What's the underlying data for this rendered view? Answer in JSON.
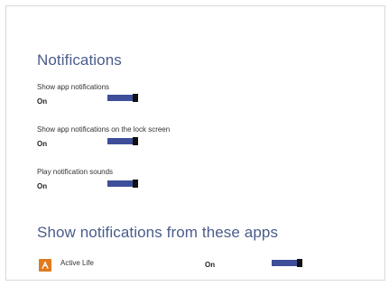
{
  "notifications": {
    "title": "Notifications",
    "settings": [
      {
        "label": "Show app notifications",
        "value": "On",
        "toggle_on": true
      },
      {
        "label": "Show app notifications on the lock screen",
        "value": "On",
        "toggle_on": true
      },
      {
        "label": "Play notification sounds",
        "value": "On",
        "toggle_on": true
      }
    ]
  },
  "apps_section": {
    "title": "Show notifications from these apps",
    "apps": [
      {
        "name": "Active Life",
        "value": "On",
        "toggle_on": true,
        "icon": "acrobat-icon"
      }
    ]
  },
  "colors": {
    "title": "#4a5c8c",
    "toggle_track": "#3f4e9a",
    "toggle_thumb": "#111111",
    "app_icon": "#e07a1f"
  }
}
